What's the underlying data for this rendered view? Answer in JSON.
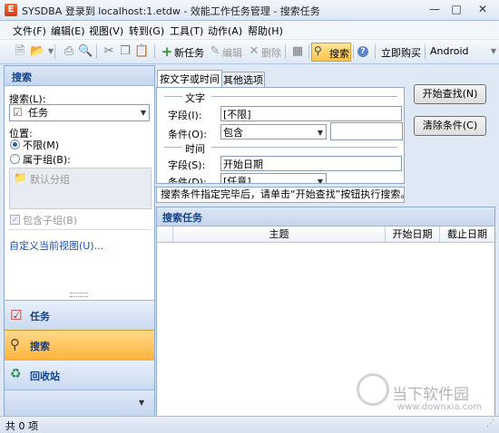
{
  "window": {
    "title": "SYSDBA 登录到 localhost:1.etdw - 效能工作任务管理 - 搜索任务",
    "app_icon_glyph": "E"
  },
  "menu": [
    {
      "label": "文件(F)"
    },
    {
      "label": "编辑(E)"
    },
    {
      "label": "视图(V)"
    },
    {
      "label": "转到(G)"
    },
    {
      "label": "工具(T)"
    },
    {
      "label": "动作(A)"
    },
    {
      "label": "帮助(H)"
    }
  ],
  "toolbar": {
    "new_task": "新任务",
    "edit": "编辑",
    "delete": "删除",
    "search": "搜索",
    "buy_now": "立即购买",
    "android": "Android"
  },
  "left": {
    "header": "搜索",
    "search_label": "搜索(L):",
    "search_value": "任务",
    "position_label": "位置:",
    "radio_unlimited": "不限(M)",
    "radio_group": "属于组(B):",
    "group_item": "默认分组",
    "include_subgroups": "包含子组(B)",
    "custom_view_link": "自定义当前视图(U)...",
    "nav": {
      "task": "任务",
      "search": "搜索",
      "recycle": "回收站"
    }
  },
  "tabs": [
    {
      "label": "按文字或时间"
    },
    {
      "label": "其他选项"
    }
  ],
  "form": {
    "text_section": "文字",
    "field_label": "字段(I):",
    "field_value": "[不限]",
    "condition_label": "条件(O):",
    "condition_value": "包含",
    "condition_text": "",
    "time_section": "时间",
    "time_field_label": "字段(S):",
    "time_field_value": "开始日期",
    "time_condition_label": "条件(D):",
    "time_condition_value": "[任意]"
  },
  "buttons": {
    "start_search": "开始查找(N)",
    "clear_conditions": "清除条件(C)"
  },
  "hint": "搜索条件指定完毕后，请单击“开始查找”按钮执行搜索。",
  "results": {
    "header": "搜索任务",
    "columns": [
      "主题",
      "开始日期",
      "截止日期"
    ]
  },
  "status": {
    "count": "共 0 项"
  },
  "watermark": {
    "name": "当下软件园",
    "url": "www.downxia.com"
  },
  "colors": {
    "accent_orange": "#ffb33a",
    "header_blue": "#15428b"
  }
}
